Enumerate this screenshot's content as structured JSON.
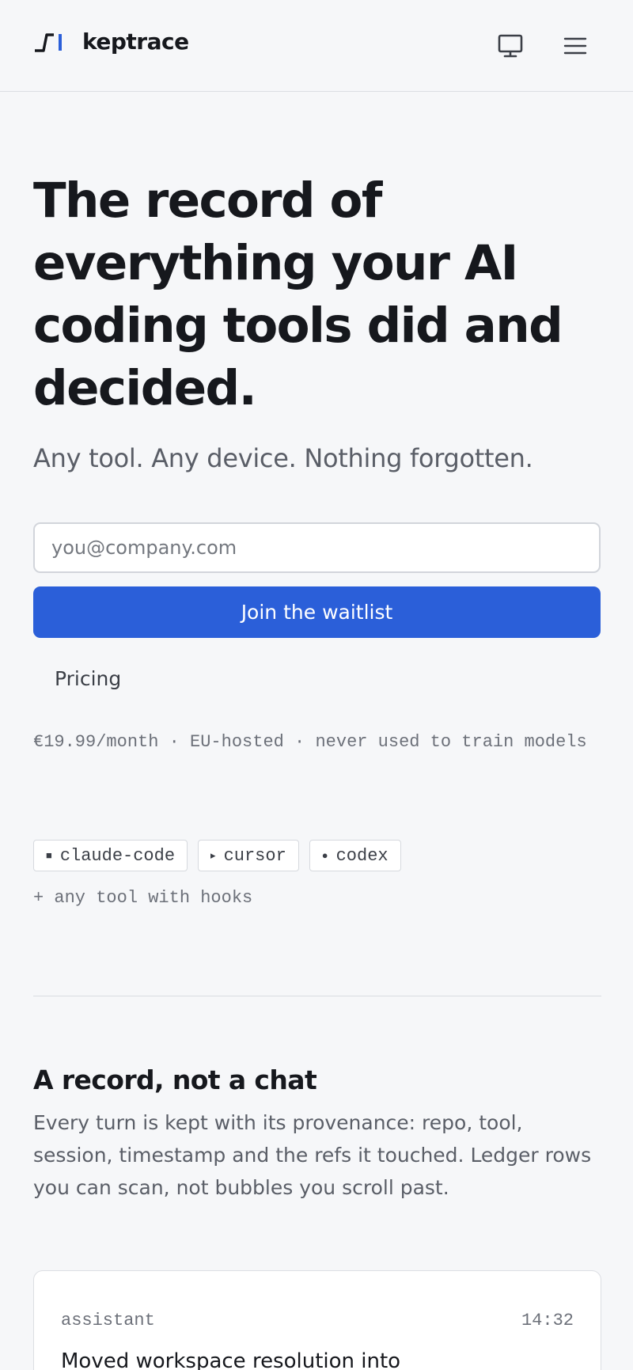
{
  "header": {
    "brand_name": "keptrace",
    "brand_icon": "keptrace-logo",
    "display_icon": "monitor-icon",
    "menu_icon": "hamburger-menu-icon"
  },
  "hero": {
    "title": "The record of everything your AI coding tools did and decided.",
    "tagline": "Any tool. Any device. Nothing forgotten."
  },
  "signup": {
    "email_placeholder": "you@company.com",
    "email_value": "",
    "cta_label": "Join the waitlist"
  },
  "pricing": {
    "link_label": "Pricing",
    "note": "€19.99/month · EU-hosted · never used to train models"
  },
  "tools": {
    "chips": [
      {
        "glyph": "■",
        "label": "claude-code"
      },
      {
        "glyph": "▸",
        "label": "cursor"
      },
      {
        "glyph": "●",
        "label": "codex"
      }
    ],
    "note": "+ any tool with hooks"
  },
  "record_section": {
    "title": "A record, not a chat",
    "body": "Every turn is kept with its provenance: repo, tool, session, timestamp and the refs it touched. Ledger rows you can scan, not bubbles you scroll past."
  },
  "ledger_entry": {
    "role": "assistant",
    "time": "14:32",
    "text": "Moved workspace resolution into"
  },
  "colors": {
    "accent": "#2b5fd9",
    "background": "#f6f7f9",
    "text": "#16181d",
    "muted": "#5a5e67"
  }
}
